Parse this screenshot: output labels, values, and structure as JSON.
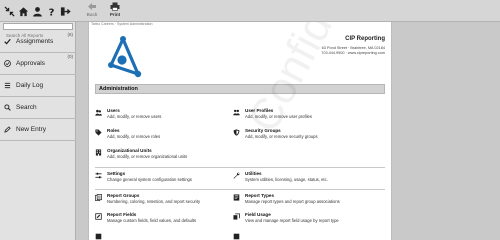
{
  "toolbar": {
    "back_label": "Back",
    "print_label": "Print"
  },
  "search": {
    "placeholder": "Search All Reports"
  },
  "nav": [
    {
      "label": "Assignments",
      "count": "(8)"
    },
    {
      "label": "Approvals",
      "count": "(0)"
    },
    {
      "label": "Daily Log",
      "count": ""
    },
    {
      "label": "Search",
      "count": ""
    },
    {
      "label": "New Entry",
      "count": ""
    }
  ],
  "breadcrumb": "Tarbo Careers · System Administration",
  "company": {
    "name": "CIP Reporting",
    "address": "63 Pond Street · Braintree, MA 02184",
    "contact": "703.444.9900 · www.cipreporting.com"
  },
  "section_title": "Administration",
  "watermark": "Confidential",
  "tiles": {
    "users": {
      "title": "Users",
      "desc": "Add, modify, or remove users"
    },
    "user_profiles": {
      "title": "User Profiles",
      "desc": "Add, modify, or remove user profiles"
    },
    "roles": {
      "title": "Roles",
      "desc": "Add, modify, or remove roles"
    },
    "security_groups": {
      "title": "Security Groups",
      "desc": "Add, modify, or remove security groups"
    },
    "org_units": {
      "title": "Organizational Units",
      "desc": "Add, modify, or remove organizational units"
    },
    "settings": {
      "title": "Settings",
      "desc": "Change general system configuration settings"
    },
    "utilities": {
      "title": "Utilities",
      "desc": "System utilities, licensing, usage, status, etc."
    },
    "report_groups": {
      "title": "Report Groups",
      "desc": "Numbering, coloring, retention, and report security"
    },
    "report_types": {
      "title": "Report Types",
      "desc": "Manage report types and report group associations"
    },
    "report_fields": {
      "title": "Report Fields",
      "desc": "Manage custom fields, field values, and defaults"
    },
    "field_usage": {
      "title": "Field Usage",
      "desc": "View and manage report field usage by report type"
    }
  },
  "colors": {
    "accent": "#1d6fb5",
    "sidebar_bg": "#e2e2e2",
    "header_bar": "#d2d2d2"
  }
}
